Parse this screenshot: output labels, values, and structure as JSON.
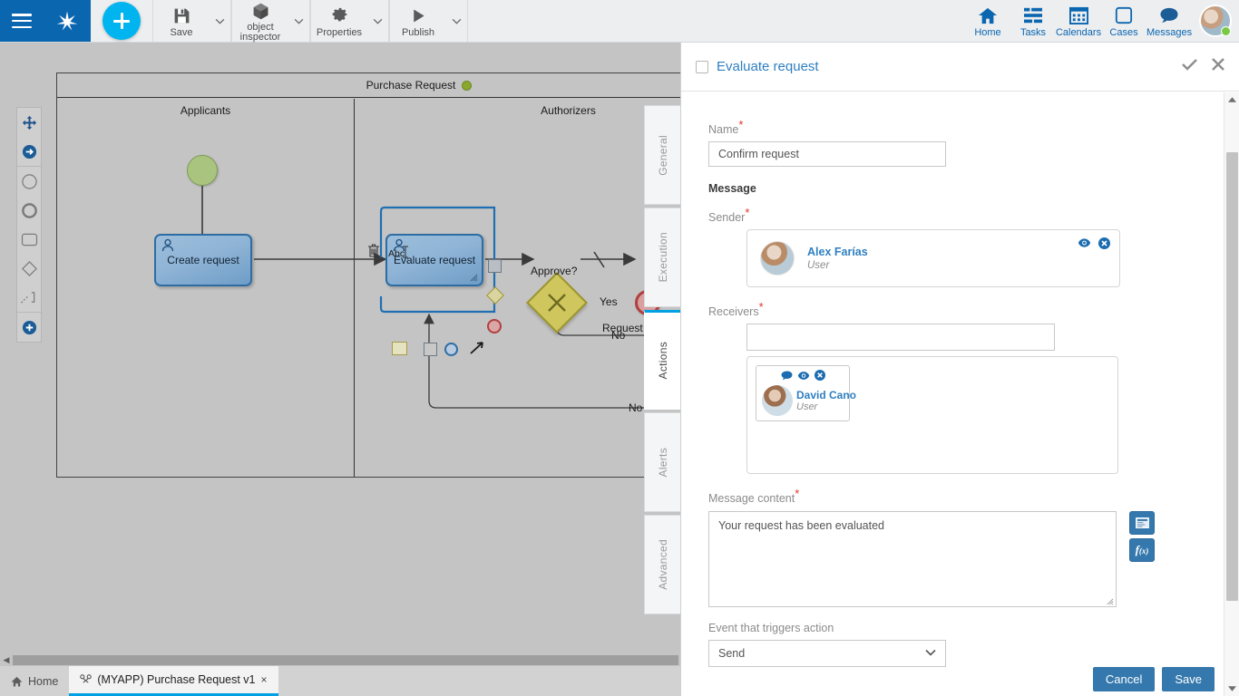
{
  "toolbar": {
    "menu_icon": "hamburger-icon",
    "logo_icon": "bonita-logo-icon",
    "add_icon": "plus-icon",
    "items": [
      {
        "label": "Save",
        "icon": "save-icon"
      },
      {
        "label": "object inspector",
        "icon": "cube-icon"
      },
      {
        "label": "Properties",
        "icon": "gear-icon"
      },
      {
        "label": "Publish",
        "icon": "play-icon"
      }
    ],
    "right_items": [
      {
        "label": "Home",
        "icon": "home-icon"
      },
      {
        "label": "Tasks",
        "icon": "tasks-icon"
      },
      {
        "label": "Calendars",
        "icon": "calendar-icon"
      },
      {
        "label": "Cases",
        "icon": "cases-icon"
      },
      {
        "label": "Messages",
        "icon": "message-icon"
      }
    ],
    "avatar": "user-avatar",
    "status": "online"
  },
  "palette": {
    "items": [
      {
        "icon": "move-tool-icon"
      },
      {
        "icon": "connector-arrow-icon"
      },
      {
        "icon": "start-event-icon"
      },
      {
        "icon": "end-event-icon"
      },
      {
        "icon": "task-icon"
      },
      {
        "icon": "gateway-icon"
      },
      {
        "icon": "sequence-flow-icon"
      },
      {
        "icon": "add-element-icon"
      }
    ]
  },
  "diagram": {
    "pool_title": "Purchase Request",
    "lanes": [
      {
        "name": "Applicants"
      },
      {
        "name": "Authorizers"
      }
    ],
    "nodes": [
      {
        "id": "start",
        "type": "start-event",
        "label": ""
      },
      {
        "id": "create",
        "type": "user-task",
        "label": "Create request"
      },
      {
        "id": "evaluate",
        "type": "user-task",
        "label": "Evaluate request",
        "selected": true
      },
      {
        "id": "approve",
        "type": "exclusive-gateway",
        "label": "Approve?"
      },
      {
        "id": "end",
        "type": "end-event",
        "label": "Request"
      }
    ],
    "flow_labels": {
      "yes": "Yes",
      "no1": "No",
      "no2": "No"
    },
    "toolbar_hint": "Abc"
  },
  "panel": {
    "title": "Evaluate request",
    "checkbox_icon": "checkbox-unchecked-icon",
    "confirm_icon": "check-icon",
    "close_icon": "close-icon",
    "tabs": [
      {
        "label": "General",
        "active": false
      },
      {
        "label": "Execution",
        "active": false
      },
      {
        "label": "Actions",
        "active": true
      },
      {
        "label": "Alerts",
        "active": false
      },
      {
        "label": "Advanced",
        "active": false
      }
    ],
    "form": {
      "name_label": "Name",
      "name_value": "Confirm request",
      "message_label": "Message",
      "sender_label": "Sender",
      "sender": {
        "name": "Alex Farías",
        "role": "User",
        "icons": [
          "eye-icon",
          "remove-icon"
        ]
      },
      "receivers_label": "Receivers",
      "receivers_input_value": "",
      "receivers": [
        {
          "name": "David Cano",
          "role": "User",
          "icons": [
            "comment-icon",
            "eye-icon",
            "remove-icon"
          ]
        }
      ],
      "message_content_label": "Message content",
      "message_content_value": "Your request has been evaluated",
      "side_buttons": [
        {
          "icon": "form-template-icon"
        },
        {
          "icon": "function-fx-icon"
        }
      ],
      "event_label": "Event that triggers action",
      "event_value": "Send",
      "event_options": [
        "Send"
      ]
    },
    "footer": {
      "cancel": "Cancel",
      "save": "Save"
    }
  },
  "taskbar": {
    "home_label": "Home",
    "home_icon": "home-icon",
    "tabs": [
      {
        "label": "(MYAPP) Purchase Request v1",
        "icon": "process-icon",
        "close": "×",
        "active": true
      }
    ]
  },
  "colors": {
    "brand_blue": "#0b66b0",
    "accent_cyan": "#00b5ef",
    "tab_active": "#00a0e3",
    "button_blue": "#3478ad",
    "required_red": "#e2322a",
    "link_blue": "#2f7fc1",
    "canvas_gray": "#c4c4c4"
  }
}
